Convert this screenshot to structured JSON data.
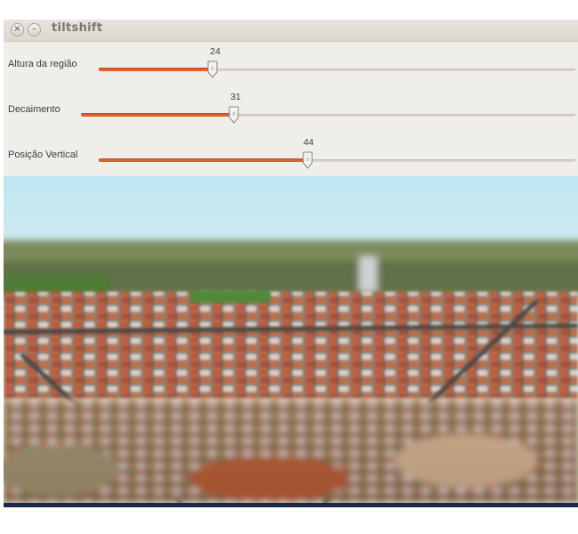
{
  "window": {
    "title": "tiltshift",
    "close_glyph": "×",
    "minimize_glyph": "–"
  },
  "sliders": [
    {
      "label": "Altura da região",
      "value": 24,
      "fraction": 0.24
    },
    {
      "label": "Decaimento",
      "value": 31,
      "fraction": 0.31
    },
    {
      "label": "Posição Vertical",
      "value": 44,
      "fraction": 0.44
    }
  ],
  "colors": {
    "slider_fill": "#e0602c",
    "window_bg": "#f0eeea"
  },
  "image": {
    "subject": "aerial-city-tiltshift-photo"
  }
}
